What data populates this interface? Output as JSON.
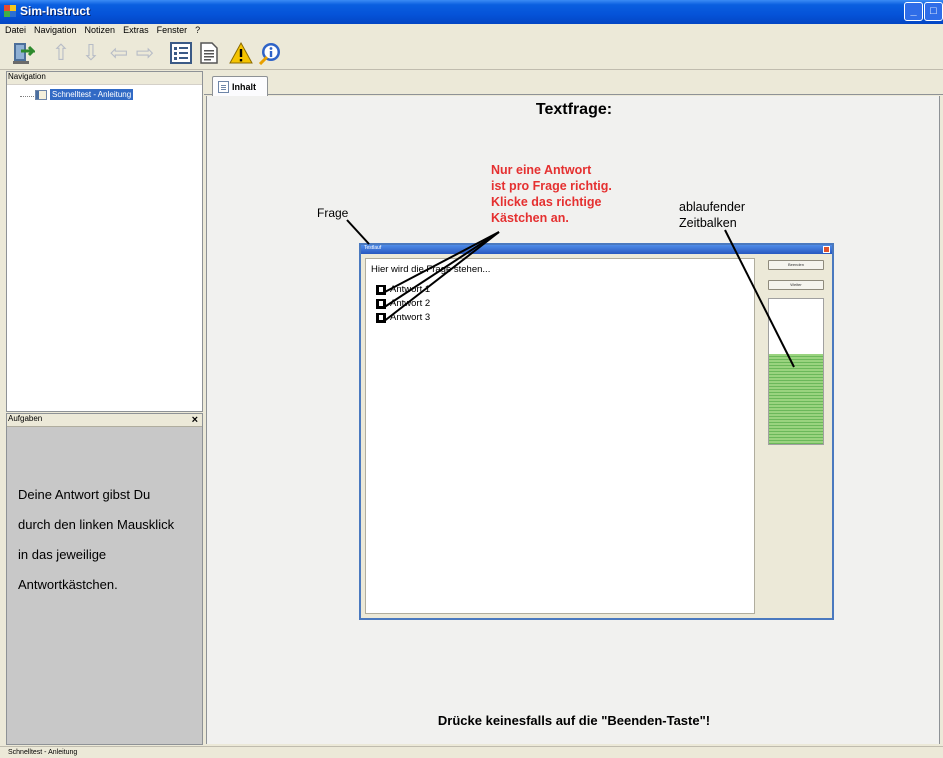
{
  "window": {
    "title": "Sim-Instruct",
    "min_glyph": "_",
    "max_glyph": "□",
    "close_glyph": "x"
  },
  "menu": [
    "Datei",
    "Navigation",
    "Notizen",
    "Extras",
    "Fenster",
    "?"
  ],
  "toolbar": {
    "icons": [
      "exit-icon",
      "arrow-up-icon",
      "arrow-down-icon",
      "arrow-left-icon",
      "arrow-right-icon",
      "list-icon",
      "page-icon",
      "warning-icon",
      "info-icon"
    ]
  },
  "navigation": {
    "header": "Navigation",
    "items": [
      {
        "label": "Schnelltest - Anleitung"
      }
    ]
  },
  "tasks": {
    "header": "Aufgaben",
    "close_glyph": "×",
    "lines": [
      "Deine Antwort gibst Du",
      "durch den linken Mausklick",
      "in das jeweilige",
      "Antwortkästchen."
    ]
  },
  "content": {
    "tab_label": "Inhalt",
    "title": "Textfrage:",
    "red_note": [
      "Nur eine Antwort",
      "ist pro Frage richtig.",
      "Klicke das richtige",
      "Kästchen an."
    ],
    "label_frage": "Frage",
    "label_zeit": [
      "ablaufender",
      "Zeitbalken"
    ],
    "bottom_warning": "Drücke keinesfalls auf die \"Beenden-Taste\"!"
  },
  "inner_window": {
    "title": "Testlauf",
    "question": "Hier wird die Frage stehen...",
    "answers": [
      "Antwort 1",
      "Antwort 2",
      "Antwort 3"
    ],
    "button_1": "Beenden",
    "button_2": "Weiter",
    "time_remaining_fraction": 0.62
  },
  "status": {
    "text": "Schnelltest - Anleitung"
  },
  "colors": {
    "accent_blue": "#0553d8",
    "note_red": "#e53030",
    "timebar_green": "#9ad37f"
  }
}
